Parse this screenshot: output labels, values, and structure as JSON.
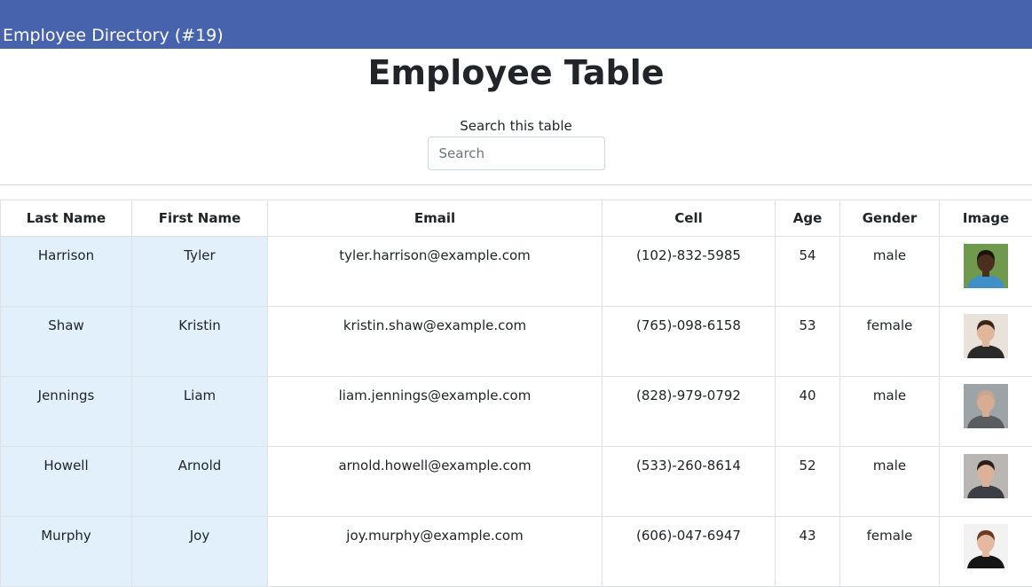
{
  "navbar": {
    "brand": "Employee Directory (#19)"
  },
  "main": {
    "title": "Employee Table",
    "search": {
      "label": "Search this table",
      "placeholder": "Search",
      "value": ""
    }
  },
  "table": {
    "headers": [
      "Last Name",
      "First Name",
      "Email",
      "Cell",
      "Age",
      "Gender",
      "Image"
    ],
    "rows": [
      {
        "last": "Harrison",
        "first": "Tyler",
        "email": "tyler.harrison@example.com",
        "cell": "(102)-832-5985",
        "age": "54",
        "gender": "male",
        "photo": {
          "bg": "#6f9a4e",
          "skin": "#4a2e1e",
          "shirt": "#3f8fc8",
          "hair": "#1b120c"
        }
      },
      {
        "last": "Shaw",
        "first": "Kristin",
        "email": "kristin.shaw@example.com",
        "cell": "(765)-098-6158",
        "age": "53",
        "gender": "female",
        "photo": {
          "bg": "#e9e2da",
          "skin": "#e0b79b",
          "shirt": "#2a2a2a",
          "hair": "#3a2417"
        }
      },
      {
        "last": "Jennings",
        "first": "Liam",
        "email": "liam.jennings@example.com",
        "cell": "(828)-979-0792",
        "age": "40",
        "gender": "male",
        "photo": {
          "bg": "#9da4a8",
          "skin": "#d8ab92",
          "shirt": "#5a5d60",
          "hair": "#c9a58f"
        }
      },
      {
        "last": "Howell",
        "first": "Arnold",
        "email": "arnold.howell@example.com",
        "cell": "(533)-260-8614",
        "age": "52",
        "gender": "male",
        "photo": {
          "bg": "#b9b6b3",
          "skin": "#dcb19a",
          "shirt": "#3b3f45",
          "hair": "#2b1e16"
        }
      },
      {
        "last": "Murphy",
        "first": "Joy",
        "email": "joy.murphy@example.com",
        "cell": "(606)-047-6947",
        "age": "43",
        "gender": "female",
        "photo": {
          "bg": "#f2f2f2",
          "skin": "#e5b9a0",
          "shirt": "#161616",
          "hair": "#6b3a22"
        }
      }
    ]
  }
}
